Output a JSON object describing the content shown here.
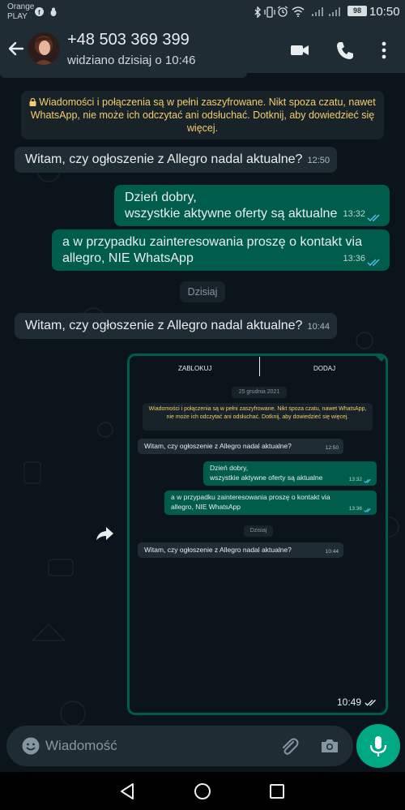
{
  "status_bar": {
    "carrier_line1": "Orange",
    "carrier_line2": "PLAY",
    "battery": "98",
    "time": "10:50"
  },
  "header": {
    "contact_name": "+48 503 369 399",
    "last_seen": "widziano dzisiaj o 10:46",
    "icons": [
      "back-arrow-icon",
      "video-call-icon",
      "phone-icon",
      "more-vert-icon"
    ]
  },
  "chat": {
    "encryption_notice": "Wiadomości i połączenia są w pełni zaszyfrowane. Nikt spoza czatu, nawet WhatsApp, nie może ich odczytać ani odsłuchać. Dotknij, aby dowiedzieć się więcej.",
    "messages": [
      {
        "direction": "in",
        "text": "Witam, czy ogłoszenie z Allegro nadal aktualne?",
        "time": "12:50"
      },
      {
        "direction": "out",
        "line1": "Dzień dobry,",
        "line2": "wszystkie aktywne oferty są aktualne",
        "time": "13:32",
        "status": "read"
      },
      {
        "direction": "out",
        "line1": "a w przypadku zainteresowania proszę o kontakt via",
        "line2": "allegro, NIE WhatsApp",
        "time": "13:36",
        "status": "read"
      }
    ],
    "date_divider": "Dzisiaj",
    "today_message": {
      "direction": "in",
      "text": "Witam, czy ogłoszenie z Allegro nadal aktualne?",
      "time": "10:44"
    },
    "image_message": {
      "time": "10:49",
      "status": "delivered",
      "screenshot": {
        "block_label": "ZABLOKUJ",
        "add_label": "DODAJ",
        "date_chip": "25 grudnia 2021",
        "encryption_notice": "Wiadomości i połączenia są w pełni zaszyfrowane. Nikt spoza czatu, nawet WhatsApp, nie może ich odczytać ani odsłuchać. Dotknij, aby dowiedzieć się więcej.",
        "msg1": {
          "text": "Witam, czy ogłoszenie z Allegro nadal aktualne?",
          "time": "12:50"
        },
        "msg2": {
          "line1": "Dzień dobry,",
          "line2": "wszystkie aktywne oferty są aktualne",
          "time": "13:32"
        },
        "msg3": {
          "line1": "a w przypadku zainteresowania proszę o kontakt via",
          "line2": "allegro, NIE WhatsApp",
          "time": "13:36"
        },
        "date_divider": "Dzisiaj",
        "msg4": {
          "text": "Witam, czy ogłoszenie z Allegro nadal aktualne?",
          "time": "10:44"
        }
      }
    }
  },
  "input": {
    "placeholder": "Wiadomość"
  },
  "colors": {
    "accent": "#00a884",
    "outgoing_bubble": "#005c4b",
    "incoming_bubble": "#202c33",
    "header": "#1f2c34",
    "read_ticks": "#53bdeb"
  }
}
